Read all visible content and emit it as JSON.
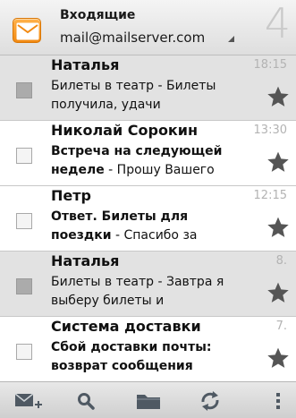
{
  "header": {
    "title": "Входящие",
    "account": "mail@mailserver.com",
    "unread_count": "4",
    "app_icon": "mail-envelope-icon",
    "accent_color": "#f59a1f"
  },
  "messages": [
    {
      "sender": "Наталья",
      "subject": "",
      "snippet": "Билеты в театр - Билеты получила, удачи",
      "time": "18:15",
      "read": true
    },
    {
      "sender": "Николай Сорокин",
      "subject": "Встреча на следующей неделе",
      "snippet": " - Прошу Вашего",
      "time": "13:30",
      "read": false
    },
    {
      "sender": "Петр",
      "subject": "Ответ. Билеты для поездки",
      "snippet": " - Спасибо за",
      "time": "12:15",
      "read": false
    },
    {
      "sender": "Наталья",
      "subject": "",
      "snippet": "Билеты в театр - Завтра я выберу билеты и",
      "time": "8.",
      "read": true
    },
    {
      "sender": "Система доставки",
      "subject": "Сбой доставки почты: возврат сообщения",
      "snippet": "",
      "time": "7.",
      "read": false
    }
  ],
  "toolbar": {
    "items": [
      "compose-icon",
      "search-icon",
      "folder-icon",
      "refresh-icon",
      "overflow-menu-icon"
    ]
  }
}
